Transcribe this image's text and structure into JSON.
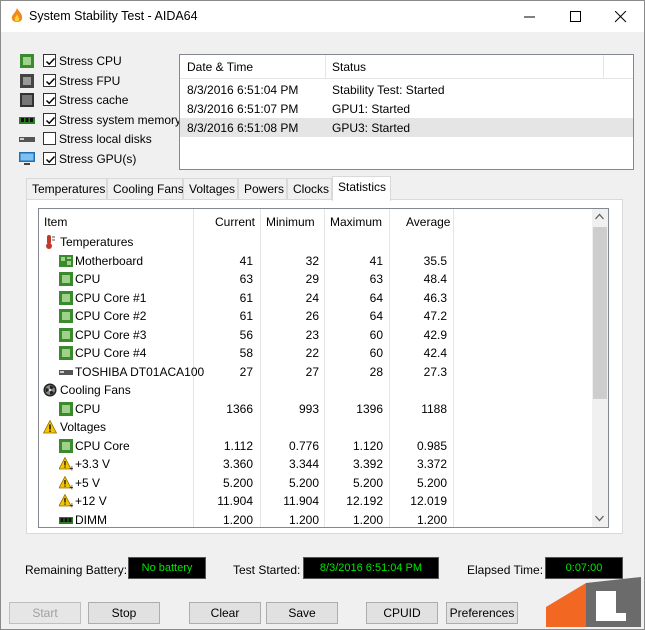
{
  "window": {
    "title": "System Stability Test - AIDA64"
  },
  "options": [
    {
      "label": "Stress CPU",
      "checked": true,
      "icon": "cpu-chip-icon"
    },
    {
      "label": "Stress FPU",
      "checked": true,
      "icon": "fpu-chip-icon"
    },
    {
      "label": "Stress cache",
      "checked": true,
      "icon": "cache-chip-icon"
    },
    {
      "label": "Stress system memory",
      "checked": true,
      "icon": "memory-module-icon"
    },
    {
      "label": "Stress local disks",
      "checked": false,
      "icon": "disk-drive-icon"
    },
    {
      "label": "Stress GPU(s)",
      "checked": true,
      "icon": "monitor-icon"
    }
  ],
  "log": {
    "headers": {
      "datetime": "Date & Time",
      "status": "Status"
    },
    "rows": [
      {
        "datetime": "8/3/2016 6:51:04 PM",
        "status": "Stability Test: Started"
      },
      {
        "datetime": "8/3/2016 6:51:07 PM",
        "status": "GPU1: Started"
      },
      {
        "datetime": "8/3/2016 6:51:08 PM",
        "status": "GPU3: Started"
      }
    ]
  },
  "tabs": [
    "Temperatures",
    "Cooling Fans",
    "Voltages",
    "Powers",
    "Clocks",
    "Statistics"
  ],
  "stats": {
    "headers": {
      "item": "Item",
      "current": "Current",
      "minimum": "Minimum",
      "maximum": "Maximum",
      "average": "Average"
    },
    "groups": {
      "temperatures": "Temperatures",
      "fans": "Cooling Fans",
      "voltages": "Voltages"
    },
    "rows": {
      "motherboard": {
        "name": "Motherboard",
        "cur": "41",
        "min": "32",
        "max": "41",
        "avg": "35.5"
      },
      "cpu": {
        "name": "CPU",
        "cur": "63",
        "min": "29",
        "max": "63",
        "avg": "48.4"
      },
      "core1": {
        "name": "CPU Core #1",
        "cur": "61",
        "min": "24",
        "max": "64",
        "avg": "46.3"
      },
      "core2": {
        "name": "CPU Core #2",
        "cur": "61",
        "min": "26",
        "max": "64",
        "avg": "47.2"
      },
      "core3": {
        "name": "CPU Core #3",
        "cur": "56",
        "min": "23",
        "max": "60",
        "avg": "42.9"
      },
      "core4": {
        "name": "CPU Core #4",
        "cur": "58",
        "min": "22",
        "max": "60",
        "avg": "42.4"
      },
      "toshiba": {
        "name": "TOSHIBA DT01ACA100",
        "cur": "27",
        "min": "27",
        "max": "28",
        "avg": "27.3"
      },
      "fan_cpu": {
        "name": "CPU",
        "cur": "1366",
        "min": "993",
        "max": "1396",
        "avg": "1188"
      },
      "vcore": {
        "name": "CPU Core",
        "cur": "1.112",
        "min": "0.776",
        "max": "1.120",
        "avg": "0.985"
      },
      "v33": {
        "name": "+3.3 V",
        "cur": "3.360",
        "min": "3.344",
        "max": "3.392",
        "avg": "3.372"
      },
      "v5": {
        "name": "+5 V",
        "cur": "5.200",
        "min": "5.200",
        "max": "5.200",
        "avg": "5.200"
      },
      "v12": {
        "name": "+12 V",
        "cur": "11.904",
        "min": "11.904",
        "max": "12.192",
        "avg": "12.019"
      },
      "dimm": {
        "name": "DIMM",
        "cur": "1.200",
        "min": "1.200",
        "max": "1.200",
        "avg": "1.200"
      }
    }
  },
  "status": {
    "battery_label": "Remaining Battery:",
    "battery_value": "No battery",
    "started_label": "Test Started:",
    "started_value": "8/3/2016 6:51:04 PM",
    "elapsed_label": "Elapsed Time:",
    "elapsed_value": "0:07:00"
  },
  "buttons": {
    "start": "Start",
    "stop": "Stop",
    "clear": "Clear",
    "save": "Save",
    "cpuid": "CPUID",
    "preferences": "Preferences"
  },
  "colors": {
    "lcd_text": "#00e600",
    "lcd_bg": "#000000",
    "chip_green": "#3a8a2e",
    "warning_yellow": "#f5c400",
    "logo_orange": "#f26722"
  }
}
